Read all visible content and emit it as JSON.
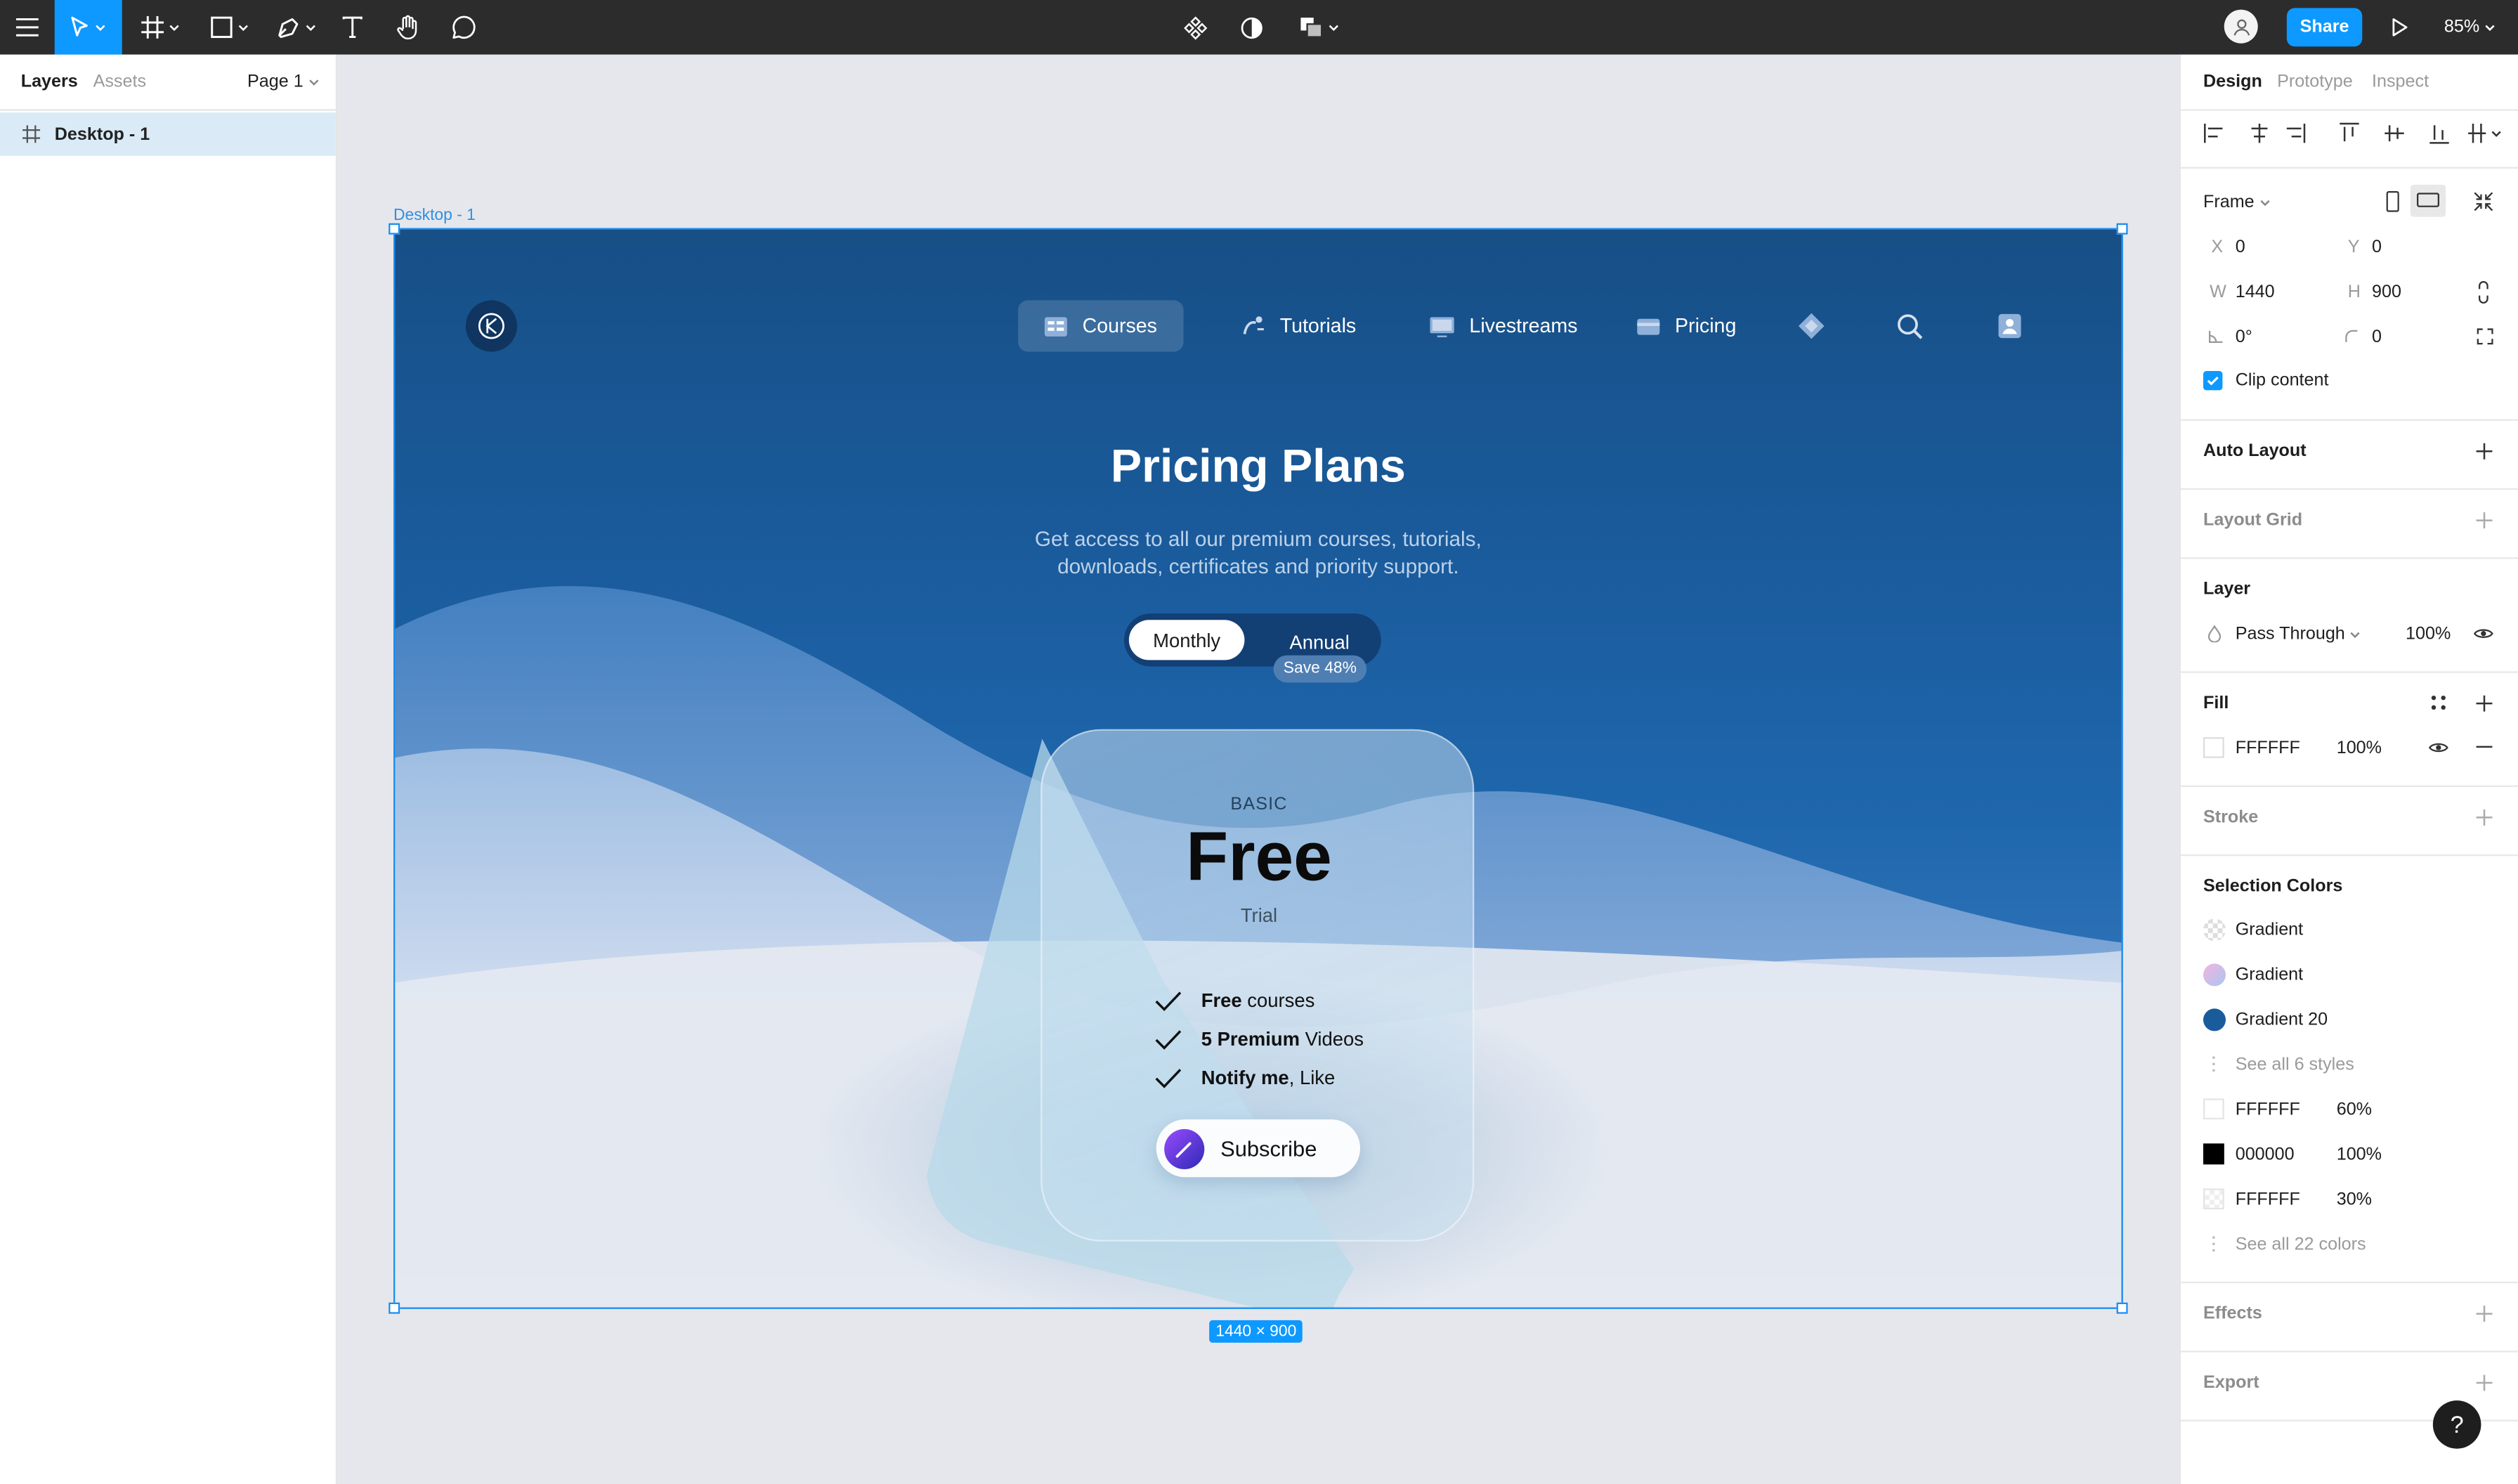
{
  "toolbar": {
    "zoom": "85%",
    "share_label": "Share",
    "menu_icon": "menu-icon",
    "move_icon": "move-tool-icon",
    "frame_icon": "frame-tool-icon",
    "shape_icon": "rectangle-tool-icon",
    "pen_icon": "pen-tool-icon",
    "text_icon": "text-tool-icon",
    "hand_icon": "hand-tool-icon",
    "comment_icon": "comment-tool-icon",
    "accent_color": "#0d99ff",
    "bg_color": "#2c2c2c"
  },
  "left_panel": {
    "tabs": [
      "Layers",
      "Assets"
    ],
    "page": "Page 1",
    "layers": [
      {
        "name": "Desktop - 1"
      }
    ]
  },
  "canvas": {
    "frame_label": "Desktop - 1",
    "size_badge": "1440 × 900"
  },
  "design": {
    "nav": [
      {
        "label": "Courses",
        "icon": "courses-icon"
      },
      {
        "label": "Tutorials",
        "icon": "tutorials-icon"
      },
      {
        "label": "Livestreams",
        "icon": "livestreams-icon"
      },
      {
        "label": "Pricing",
        "icon": "pricing-icon"
      }
    ],
    "title": "Pricing Plans",
    "subtitle": "Get access to all our premium courses, tutorials, downloads, certificates and priority support.",
    "toggle": {
      "monthly": "Monthly",
      "annual": "Annual",
      "save": "Save 48%"
    },
    "card": {
      "tier": "BASIC",
      "price": "Free",
      "period": "Trial",
      "features": [
        {
          "bold": "Free",
          "rest": " courses"
        },
        {
          "bold": "5 Premium",
          "rest": " Videos"
        },
        {
          "bold": "Notify me",
          "rest": ", Like"
        }
      ],
      "cta": "Subscribe"
    }
  },
  "right_panel": {
    "tabs": [
      "Design",
      "Prototype",
      "Inspect"
    ],
    "frame_type": "Frame",
    "x": "0",
    "y": "0",
    "w": "1440",
    "h": "900",
    "rotation": "0°",
    "radius": "0",
    "clip_content": "Clip content",
    "sections": {
      "auto_layout": "Auto Layout",
      "layout_grid": "Layout Grid",
      "layer": "Layer",
      "fill": "Fill",
      "stroke": "Stroke",
      "selection_colors": "Selection Colors",
      "effects": "Effects",
      "export": "Export"
    },
    "layer": {
      "blend": "Pass Through",
      "opacity": "100%"
    },
    "fill": {
      "hex": "FFFFFF",
      "opacity": "100%"
    },
    "selection_colors": [
      {
        "name": "Gradient",
        "kind": "checker"
      },
      {
        "name": "Gradient",
        "kind": "pastel"
      },
      {
        "name": "Gradient 20",
        "kind": "blue"
      }
    ],
    "see_all_styles": "See all 6 styles",
    "colors": [
      {
        "hex": "FFFFFF",
        "opacity": "60%"
      },
      {
        "hex": "000000",
        "opacity": "100%"
      },
      {
        "hex": "FFFFFF",
        "opacity": "30%"
      }
    ],
    "see_all_colors": "See all 22 colors"
  },
  "help_label": "?"
}
